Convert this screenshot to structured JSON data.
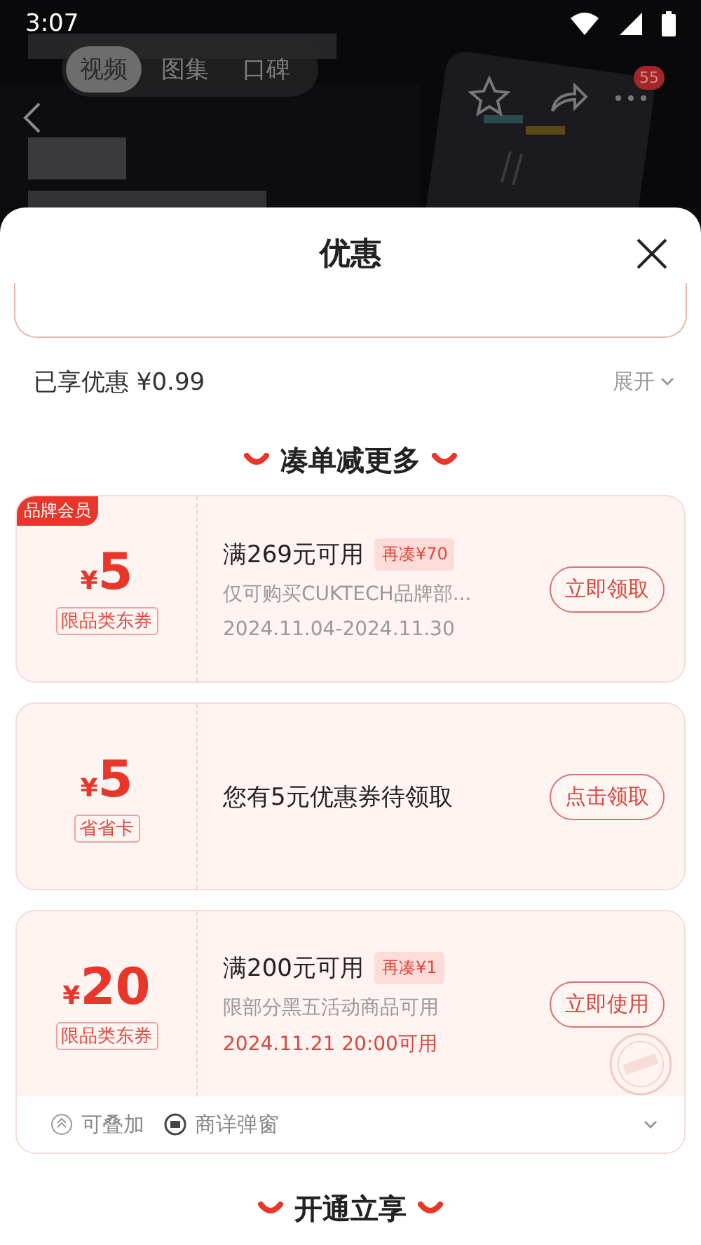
{
  "status_bar": {
    "time": "3:07"
  },
  "header": {
    "tabs": [
      {
        "label": "视频",
        "selected": true
      },
      {
        "label": "图集",
        "selected": false
      },
      {
        "label": "口碑",
        "selected": false
      }
    ],
    "badge": "55"
  },
  "sheet": {
    "title": "优惠",
    "savings": {
      "label": "已享优惠 ¥0.99",
      "expand": "展开"
    },
    "sections": [
      {
        "title": "凑单减更多",
        "coupons": [
          {
            "tag": "品牌会员",
            "currency": "¥",
            "amount": "5",
            "type_label": "限品类东券",
            "title": "满269元可用",
            "extra": "再凑¥70",
            "description": "仅可购买CUKTECH品牌部...",
            "date": "2024.11.04-2024.11.30",
            "date_highlight": false,
            "button": "立即领取",
            "claimed": false
          },
          {
            "currency": "¥",
            "amount": "5",
            "type_label": "省省卡",
            "title": "您有5元优惠券待领取",
            "button": "点击领取",
            "claimed": false
          },
          {
            "currency": "¥",
            "amount": "20",
            "type_label": "限品类东券",
            "title": "满200元可用",
            "extra": "再凑¥1",
            "description": "限部分黑五活动商品可用",
            "date": "2024.11.21 20:00可用",
            "date_highlight": true,
            "button": "立即使用",
            "claimed": true,
            "footer": [
              {
                "kind": "stack",
                "label": "可叠加"
              },
              {
                "kind": "popup",
                "label": "商详弹窗"
              }
            ]
          }
        ]
      },
      {
        "title": "开通立享"
      }
    ]
  }
}
